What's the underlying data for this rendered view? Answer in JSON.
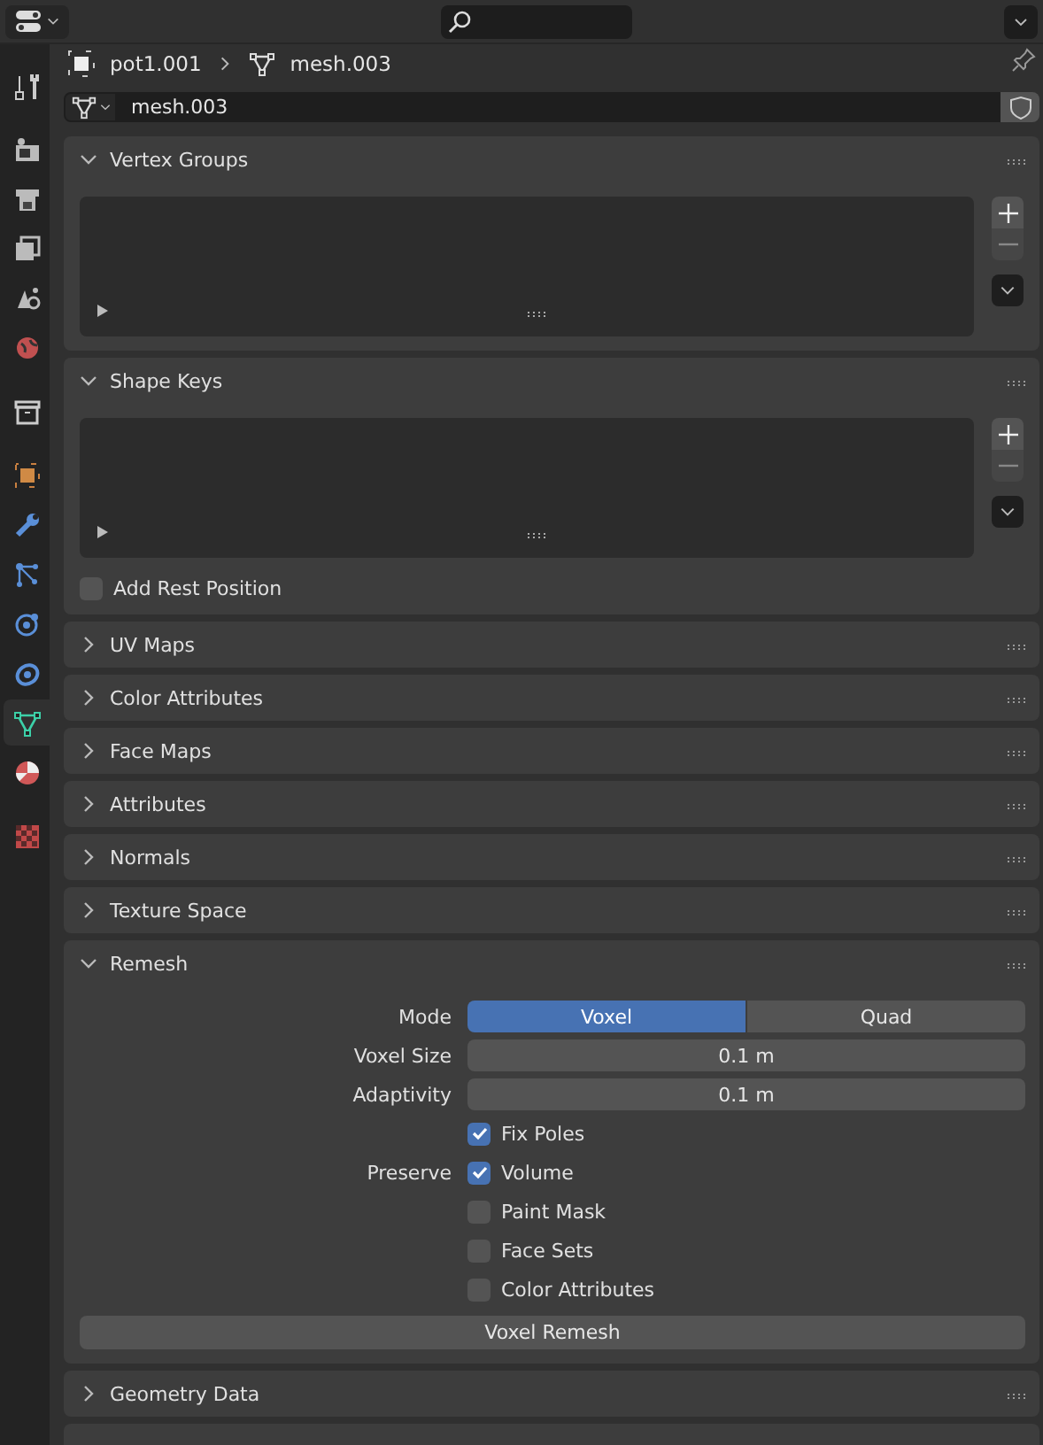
{
  "breadcrumb": {
    "object": "pot1.001",
    "data": "mesh.003"
  },
  "datablock": {
    "name": "mesh.003"
  },
  "tab_groups": [
    {
      "tabs": [
        {
          "kind": "tool",
          "selected": false
        }
      ]
    },
    {
      "tabs": [
        {
          "kind": "render",
          "selected": false
        },
        {
          "kind": "output",
          "selected": false
        },
        {
          "kind": "viewlayer",
          "selected": false
        },
        {
          "kind": "scene",
          "selected": false
        },
        {
          "kind": "world",
          "selected": false
        }
      ]
    },
    {
      "tabs": [
        {
          "kind": "collection",
          "selected": false
        }
      ]
    },
    {
      "tabs": [
        {
          "kind": "object",
          "selected": false
        },
        {
          "kind": "modifier",
          "selected": false
        },
        {
          "kind": "particles",
          "selected": false
        },
        {
          "kind": "physics",
          "selected": false
        },
        {
          "kind": "constraint",
          "selected": false
        },
        {
          "kind": "data",
          "selected": true
        },
        {
          "kind": "material",
          "selected": false
        }
      ]
    },
    {
      "tabs": [
        {
          "kind": "texture",
          "selected": false
        }
      ]
    }
  ],
  "panels": [
    {
      "title": "Vertex Groups",
      "expanded": true,
      "kind": "list"
    },
    {
      "title": "Shape Keys",
      "expanded": true,
      "kind": "list",
      "checkbox": {
        "label": "Add Rest Position",
        "checked": false
      }
    },
    {
      "title": "UV Maps",
      "expanded": false
    },
    {
      "title": "Color Attributes",
      "expanded": false
    },
    {
      "title": "Face Maps",
      "expanded": false
    },
    {
      "title": "Attributes",
      "expanded": false
    },
    {
      "title": "Normals",
      "expanded": false
    },
    {
      "title": "Texture Space",
      "expanded": false
    },
    {
      "title": "Remesh",
      "expanded": true,
      "kind": "remesh",
      "mode": {
        "label": "Mode",
        "options": [
          {
            "label": "Voxel",
            "selected": true
          },
          {
            "label": "Quad",
            "selected": false
          }
        ]
      },
      "fields": [
        {
          "label": "Voxel Size",
          "value": "0.1 m"
        },
        {
          "label": "Adaptivity",
          "value": "0.1 m"
        }
      ],
      "checks": [
        {
          "label": "Fix Poles",
          "checked": true
        },
        {
          "group": "Preserve",
          "label": "Volume",
          "checked": true
        },
        {
          "label": "Paint Mask",
          "checked": false
        },
        {
          "label": "Face Sets",
          "checked": false
        },
        {
          "label": "Color Attributes",
          "checked": false
        }
      ],
      "button": "Voxel Remesh"
    },
    {
      "title": "Geometry Data",
      "expanded": false
    }
  ]
}
